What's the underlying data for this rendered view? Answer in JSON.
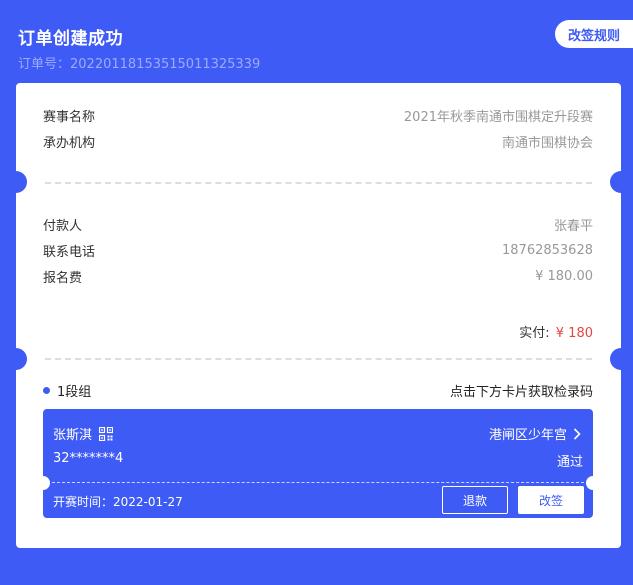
{
  "header": {
    "title": "订单创建成功",
    "order_no": "订单号：20220118153515011325339",
    "rule_button": "改签规则"
  },
  "event": {
    "name_label": "赛事名称",
    "name_value": "2021年秋季南通市围棋定升段赛",
    "org_label": "承办机构",
    "org_value": "南通市围棋协会"
  },
  "payment": {
    "payer_label": "付款人",
    "payer_value": "张春平",
    "phone_label": "联系电话",
    "phone_value": "18762853628",
    "fee_label": "报名费",
    "fee_value": "¥ 180.00",
    "paid_label": "实付:",
    "paid_value": "¥ 180"
  },
  "group": {
    "name": "1段组",
    "hint": "点击下方卡片获取检录码"
  },
  "player": {
    "name": "张斯淇",
    "venue": "港闸区少年宫",
    "id": "32*******4",
    "status": "通过",
    "start_time": "开赛时间：2022-01-27",
    "refund_button": "退款",
    "change_button": "改签"
  },
  "colors": {
    "accent": "#3f5bf6",
    "price_red": "#e54545"
  },
  "icons": {
    "qr": "qr-code-icon",
    "chevron": "chevron-right-icon"
  }
}
